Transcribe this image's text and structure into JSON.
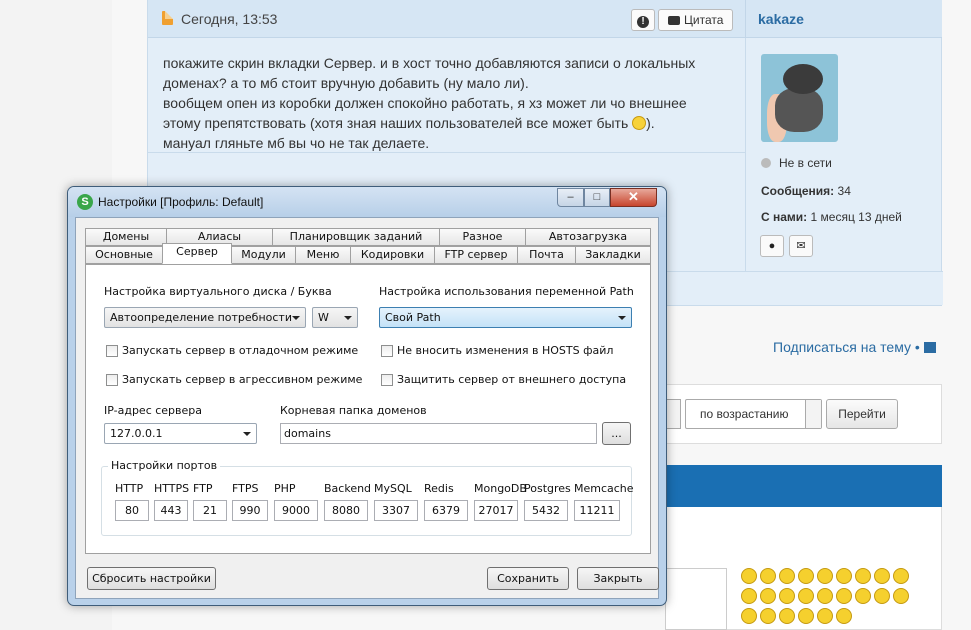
{
  "post": {
    "time": "Сегодня, 13:53",
    "flag_label": "!",
    "quote_label": "Цитата",
    "username": "kakaze",
    "text": [
      "покажите скрин вкладки Сервер. и в хост точно добавляются записи о локальных",
      "доменах? а то мб стоит вручную добавить (ну мало ли).",
      "вообщем опен из коробки должен спокойно работать, я хз может ли чо внешнее",
      "этому препятствовать (хотя зная наших пользователей все может быть",
      "). ",
      "мануал гляньте мб вы чо не так делаете."
    ]
  },
  "user": {
    "status": "Не в сети",
    "messages_label": "Сообщения:",
    "messages_value": "34",
    "with_us_label": "С нами:",
    "with_us_value": "1 месяц 13 дней"
  },
  "forum": {
    "subscribe": "Подписаться на тему",
    "sort_value": "по возрастанию",
    "go_button": "Перейти"
  },
  "dialog": {
    "title": "Настройки [Профиль: Default]",
    "logo_letter": "S",
    "min_glyph": "–",
    "max_glyph": "□",
    "close_glyph": "✕",
    "tabs_row1": [
      "Домены",
      "Алиасы",
      "Планировщик заданий",
      "Разное",
      "Автозагрузка"
    ],
    "tabs_row2": [
      "Основные",
      "Сервер",
      "Модули",
      "Меню",
      "Кодировки",
      "FTP сервер",
      "Почта",
      "Закладки"
    ],
    "active_tab": "Сервер",
    "vdisk_label": "Настройка виртуального диска / Буква",
    "vdisk_value": "Автоопределение потребности",
    "letter_value": "W",
    "path_label": "Настройка использования переменной Path",
    "path_value": "Свой Path",
    "cb_debug": "Запускать сервер в отладочном режиме",
    "cb_aggressive": "Запускать сервер в агрессивном режиме",
    "cb_hosts": "Не вносить изменения в HOSTS файл",
    "cb_protect": "Защитить сервер от внешнего доступа",
    "ip_label": "IP-адрес сервера",
    "ip_value": "127.0.0.1",
    "root_label": "Корневая папка доменов",
    "root_value": "domains",
    "browse_label": "...",
    "ports_title": "Настройки портов",
    "ports": [
      {
        "name": "HTTP",
        "value": "80"
      },
      {
        "name": "HTTPS",
        "value": "443"
      },
      {
        "name": "FTP",
        "value": "21"
      },
      {
        "name": "FTPS",
        "value": "990"
      },
      {
        "name": "PHP",
        "value": "9000"
      },
      {
        "name": "Backend",
        "value": "8080"
      },
      {
        "name": "MySQL",
        "value": "3307"
      },
      {
        "name": "Redis",
        "value": "6379"
      },
      {
        "name": "MongoDB",
        "value": "27017"
      },
      {
        "name": "Postgres",
        "value": "5432"
      },
      {
        "name": "Memcache",
        "value": "11211"
      }
    ],
    "reset_button": "Сбросить настройки",
    "save_button": "Сохранить",
    "close_button": "Закрыть"
  },
  "colors": {
    "link": "#2b6ca3",
    "post_bg": "#e3eef8",
    "blue_bar": "#1a6fb3",
    "dialog_frame": "#b9d1ea",
    "close_red": "#c7452d"
  }
}
